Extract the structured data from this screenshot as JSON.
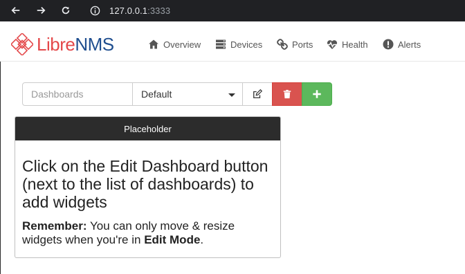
{
  "browser": {
    "url_host": "127.0.0.1",
    "url_port": ":3333"
  },
  "app": {
    "logo_libre": "Libre",
    "logo_nms": "NMS",
    "nav": [
      {
        "label": "Overview",
        "icon": "home-icon"
      },
      {
        "label": "Devices",
        "icon": "server-icon"
      },
      {
        "label": "Ports",
        "icon": "link-icon"
      },
      {
        "label": "Health",
        "icon": "heartbeat-icon"
      },
      {
        "label": "Alerts",
        "icon": "exclamation-icon"
      }
    ]
  },
  "toolbar": {
    "dashboards_placeholder": "Dashboards",
    "selected_dashboard": "Default"
  },
  "widget": {
    "header": "Placeholder",
    "title": "Click on the Edit Dashboard button (next to the list of dashboards) to add widgets",
    "remember_label": "Remember:",
    "note_text_1": " You can only move & resize widgets when you're in ",
    "edit_mode": "Edit Mode",
    "note_text_2": "."
  },
  "colors": {
    "delete": "#d9534f",
    "add": "#5cb85c",
    "widget_header": "#2c2c2c",
    "logo_red": "#e4484a",
    "logo_blue": "#1f4e8f"
  }
}
